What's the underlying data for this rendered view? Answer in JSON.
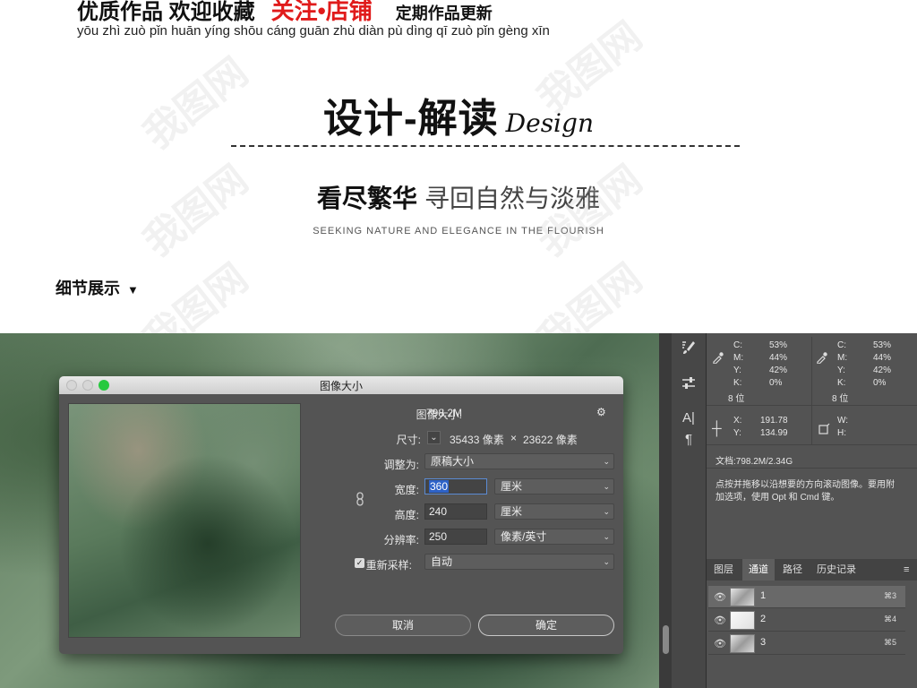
{
  "banner": {
    "lead": "优质作品 欢迎收藏",
    "accent": "关注•店铺",
    "tail": "定期作品更新",
    "pinyin": "yōu zhì zuò pǐn huān yíng shōu cáng guān zhù diàn pù dìng qī zuò pǐn gèng xīn"
  },
  "section": {
    "title_cn": "设计-解读",
    "title_en": "Design",
    "tagline_bold": "看尽繁华",
    "tagline_light": "寻回自然与淡雅",
    "tagline_en": "SEEKING NATURE AND ELEGANCE IN THE FLOURISH",
    "detail_label": "细节展示",
    "detail_arrow": "▼"
  },
  "watermark": {
    "text": "我图网"
  },
  "dialog": {
    "title": "图像大小",
    "image_size_label": "图像大小:",
    "image_size_value": "798.2M",
    "gear": "⚙",
    "dimensions_label": "尺寸:",
    "dimensions_width": "35433 像素",
    "dimensions_x": "×",
    "dimensions_height": "23622 像素",
    "fit_label": "调整为:",
    "fit_value": "原稿大小",
    "width_label": "宽度:",
    "width_value": "360",
    "width_unit": "厘米",
    "height_label": "高度:",
    "height_value": "240",
    "height_unit": "厘米",
    "resolution_label": "分辨率:",
    "resolution_value": "250",
    "resolution_unit": "像素/英寸",
    "resample_label": "重新采样:",
    "resample_value": "自动",
    "resample_checked": true,
    "cancel_label": "取消",
    "ok_label": "确定",
    "link_icon": "link-icon"
  },
  "info_panel": {
    "cmyk1": {
      "C": "53%",
      "M": "44%",
      "Y": "42%",
      "K": "0%",
      "bits": "8 位"
    },
    "cmyk2": {
      "C": "53%",
      "M": "44%",
      "Y": "42%",
      "K": "0%",
      "bits": "8 位"
    },
    "labels": {
      "C": "C:",
      "M": "M:",
      "Y": "Y:",
      "K": "K:",
      "X": "X:",
      "Yc": "Y:",
      "W": "W:",
      "H": "H:"
    },
    "x_value": "191.78",
    "y_value": "134.99",
    "doc_size": "文档:798.2M/2.34G",
    "hint_line1": "点按并拖移以沿想要的方向滚动图像。要用附",
    "hint_line2": "加选项，使用 Opt 和 Cmd 键。"
  },
  "tabs": [
    {
      "label": "图层"
    },
    {
      "label": "通道"
    },
    {
      "label": "路径"
    },
    {
      "label": "历史记录"
    }
  ],
  "channels": [
    {
      "name": "1",
      "shortcut": "⌘3"
    },
    {
      "name": "2",
      "shortcut": "⌘4"
    },
    {
      "name": "3",
      "shortcut": "⌘5"
    }
  ],
  "colors": {
    "accent_red": "#e01b1b",
    "panel_bg": "#535353",
    "dialog_bg": "#545454",
    "selection_blue": "#2d62c8",
    "traffic_red": "#d9d9d9",
    "traffic_green": "#27c93f"
  }
}
